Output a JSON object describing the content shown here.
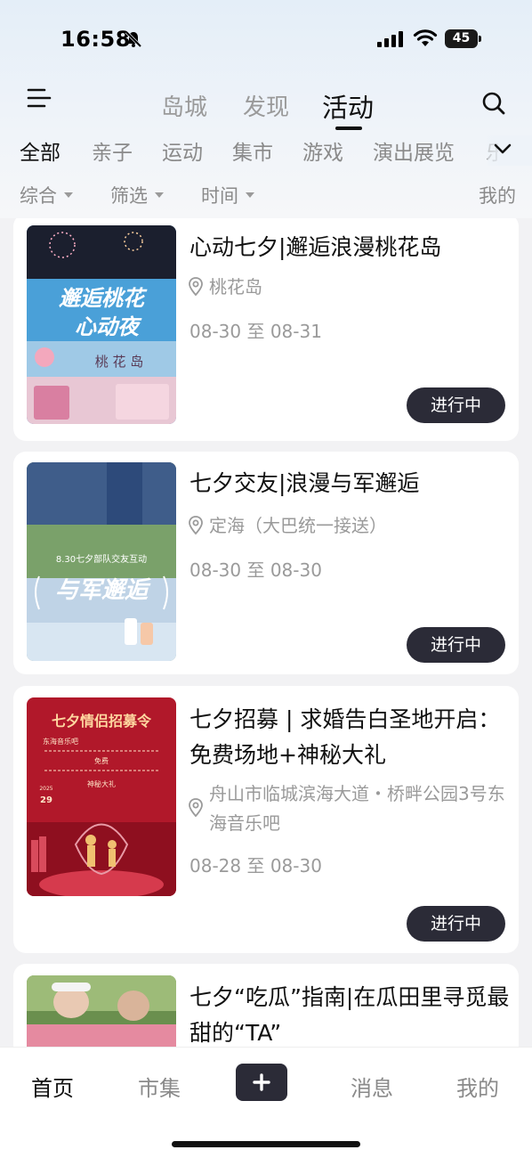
{
  "status_bar": {
    "time": "16:58",
    "battery": "45"
  },
  "top_nav": {
    "tabs": [
      {
        "label": "岛城",
        "active": false
      },
      {
        "label": "发现",
        "active": false
      },
      {
        "label": "活动",
        "active": true
      }
    ]
  },
  "categories": [
    "全部",
    "亲子",
    "运动",
    "集市",
    "游戏",
    "演出展览",
    "乐"
  ],
  "filters": {
    "sort": "综合",
    "filter": "筛选",
    "time": "时间",
    "mine": "我的"
  },
  "events": [
    {
      "title": "心动七夕|邂逅浪漫桃花岛",
      "location": "桃花岛",
      "date": "08-30 至 08-31",
      "status": "进行中",
      "poster_text": [
        "邂逅桃花",
        "心动夜",
        "桃 花 岛"
      ]
    },
    {
      "title": "七夕交友|浪漫与军邂逅",
      "location": "定海（大巴统一接送）",
      "date": "08-30 至 08-30",
      "status": "进行中",
      "poster_text": [
        "8.30七夕部队交友互动",
        "与军邂逅"
      ]
    },
    {
      "title": "七夕招募 | 求婚告白圣地开启：免费场地+神秘大礼",
      "location": "舟山市临城滨海大道・桥畔公园3号东海音乐吧",
      "date": "08-28 至 08-30",
      "status": "进行中",
      "poster_text": [
        "七夕情侣招募令",
        "东海音乐吧",
        "免费",
        "神秘大礼",
        "2025",
        "29"
      ]
    },
    {
      "title": "七夕“吃瓜”指南|在瓜田里寻觅最甜的“TA”",
      "location": "",
      "date": "",
      "status": ""
    }
  ],
  "bottom_tabs": [
    {
      "label": "首页",
      "active": true
    },
    {
      "label": "市集",
      "active": false
    },
    {
      "label": "消息",
      "active": false
    },
    {
      "label": "我的",
      "active": false
    }
  ],
  "colors": {
    "accent_dark": "#2b2b37",
    "muted_text": "#9a9a9a"
  }
}
